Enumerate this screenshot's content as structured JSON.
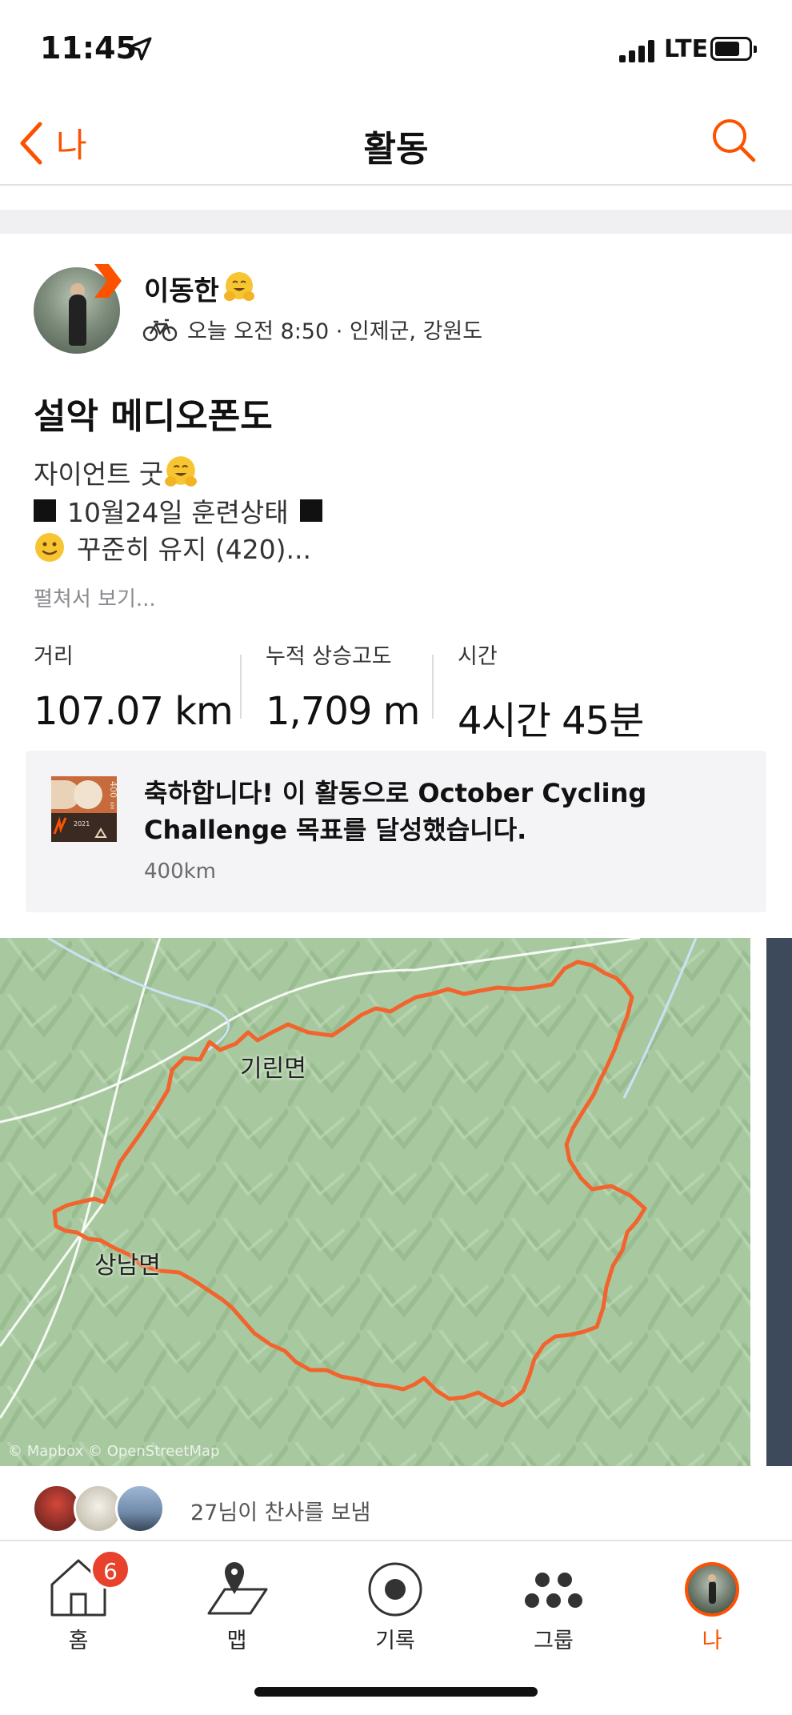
{
  "status_bar": {
    "time": "11:45",
    "network": "LTE"
  },
  "nav": {
    "back_label": "나",
    "title": "활동"
  },
  "activity": {
    "athlete_name": "이동한",
    "meta": "오늘 오전 8:50 · 인제군, 강원도",
    "title": "설악 메디오폰도",
    "description_lines": [
      "자이언트 굿",
      "10월24일 훈련상태",
      "꾸준히 유지 (420)..."
    ],
    "see_more": "펼쳐서 보기...",
    "stats": [
      {
        "label": "거리",
        "value": "107.07 km"
      },
      {
        "label": "누적 상승고도",
        "value": "1,709 m"
      },
      {
        "label": "시간",
        "value": "4시간 45분"
      }
    ]
  },
  "challenge": {
    "text": "축하합니다! 이 활동으로 October Cycling Challenge 목표를 달성했습니다.",
    "subtext": "400km",
    "badge": {
      "distance": "400",
      "unit": "KM",
      "year": "2021"
    }
  },
  "map": {
    "labels": [
      "기린면",
      "상남면"
    ],
    "attribution": "© Mapbox © OpenStreetMap"
  },
  "kudos": {
    "text": "27님이 찬사를 보냄"
  },
  "tabs": [
    {
      "label": "홈",
      "badge": "6"
    },
    {
      "label": "맵"
    },
    {
      "label": "기록"
    },
    {
      "label": "그룹"
    },
    {
      "label": "나"
    }
  ],
  "colors": {
    "accent": "#fc5200",
    "route": "#f2642d",
    "map_green": "#a8c9a0"
  }
}
